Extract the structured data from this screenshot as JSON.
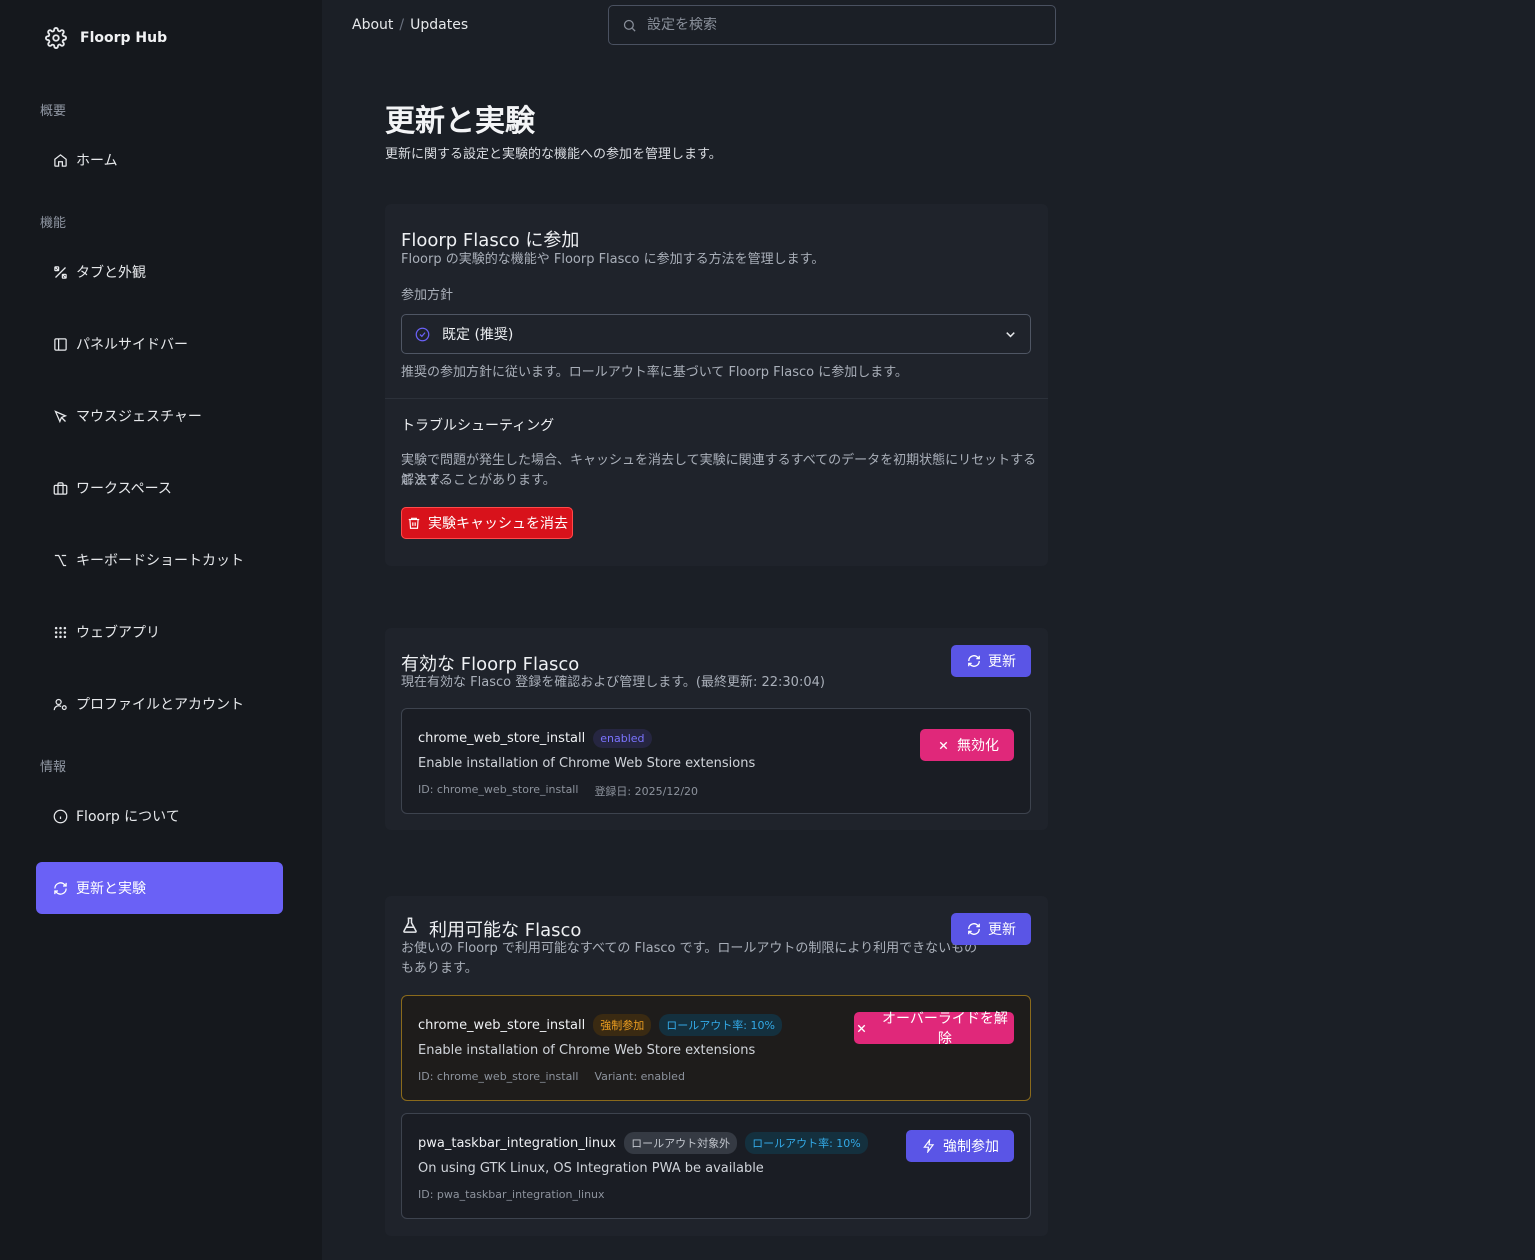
{
  "sidebar": {
    "brand": "Floorp Hub",
    "sections": {
      "overview": "概要",
      "features": "機能",
      "info": "情報"
    },
    "items": [
      {
        "label": "ホーム",
        "icon": "home-icon"
      },
      {
        "label": "タブと外観",
        "icon": "palette-icon"
      },
      {
        "label": "パネルサイドバー",
        "icon": "panel-icon"
      },
      {
        "label": "マウスジェスチャー",
        "icon": "pointer-icon"
      },
      {
        "label": "ワークスペース",
        "icon": "briefcase-icon"
      },
      {
        "label": "キーボードショートカット",
        "icon": "option-key-icon"
      },
      {
        "label": "ウェブアプリ",
        "icon": "grid-icon"
      },
      {
        "label": "プロファイルとアカウント",
        "icon": "user-icon"
      },
      {
        "label": "Floorp について",
        "icon": "info-icon"
      },
      {
        "label": "更新と実験",
        "icon": "refresh-icon",
        "active": true
      }
    ]
  },
  "breadcrumb": [
    "About",
    "Updates"
  ],
  "search": {
    "placeholder": "設定を検索"
  },
  "page": {
    "title": "更新と実験",
    "subtitle": "更新に関する設定と実験的な機能への参加を管理します。"
  },
  "participation": {
    "title": "Floorp Flasco に参加",
    "desc": "Floorp の実験的な機能や Floorp Flasco に参加する方法を管理します。",
    "policy_label": "参加方針",
    "policy_value": "既定 (推奨)",
    "policy_help": "推奨の参加方針に従います。ロールアウト率に基づいて Floorp Flasco に参加します。",
    "troubleshoot_title": "トラブルシューティング",
    "troubleshoot_desc_1": "実験で問題が発生した場合、キャッシュを消去して実験に関連するすべてのデータを初期状態にリセットすることで、",
    "troubleshoot_desc_2": "解決することがあります。",
    "clear_cache_label": "実験キャッシュを消去"
  },
  "active": {
    "title": "有効な Floorp Flasco",
    "desc": "現在有効な Flasco 登録を確認および管理します。(最終更新: 22:30:04)",
    "refresh_label": "更新",
    "items": [
      {
        "name": "chrome_web_store_install",
        "badge": "enabled",
        "desc": "Enable installation of Chrome Web Store extensions",
        "id": "ID: chrome_web_store_install",
        "date": "登録日: 2025/12/20",
        "action": "無効化"
      }
    ]
  },
  "available": {
    "title": "利用可能な Flasco",
    "desc_1": "お使いの Floorp で利用可能なすべての Flasco です。ロールアウトの制限により利用できないもの",
    "desc_2": "もあります。",
    "refresh_label": "更新",
    "items": [
      {
        "name": "chrome_web_store_install",
        "badge1": "強制参加",
        "badge2": "ロールアウト率: 10%",
        "desc": "Enable installation of Chrome Web Store extensions",
        "id": "ID: chrome_web_store_install",
        "variant": "Variant: enabled",
        "action": "オーバーライドを解除"
      },
      {
        "name": "pwa_taskbar_integration_linux",
        "badge1": "ロールアウト対象外",
        "badge2": "ロールアウト率: 10%",
        "desc": "On using GTK Linux, OS Integration PWA be available",
        "id": "ID: pwa_taskbar_integration_linux",
        "action": "強制参加"
      }
    ]
  },
  "colors": {
    "accent": "#6a61f6",
    "danger": "#d8121b",
    "pink": "#e0287a"
  }
}
